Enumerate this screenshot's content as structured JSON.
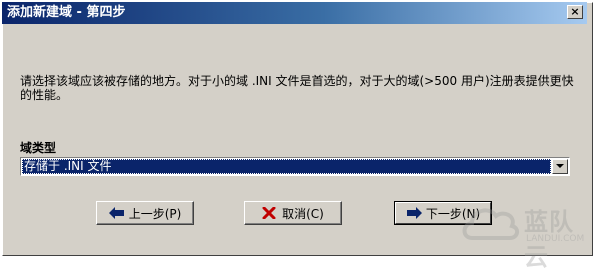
{
  "window": {
    "title": "添加新建域 - 第四步",
    "close_label": "×"
  },
  "instruction": "请选择该域应该被存储的地方。对于小的域 .INI 文件是首选的，对于大的域(>500 用户)注册表提供更快的性能。",
  "domain_type": {
    "label": "域类型",
    "selected": "存储于 .INI 文件"
  },
  "buttons": {
    "back": "上一步(P)",
    "cancel": "取消(C)",
    "next": "下一步(N)"
  },
  "watermark": {
    "text": "蓝队云",
    "sub": "LANDUI.COM"
  },
  "icons": {
    "back": "arrow-left-icon",
    "cancel": "x-icon",
    "next": "arrow-right-icon"
  }
}
